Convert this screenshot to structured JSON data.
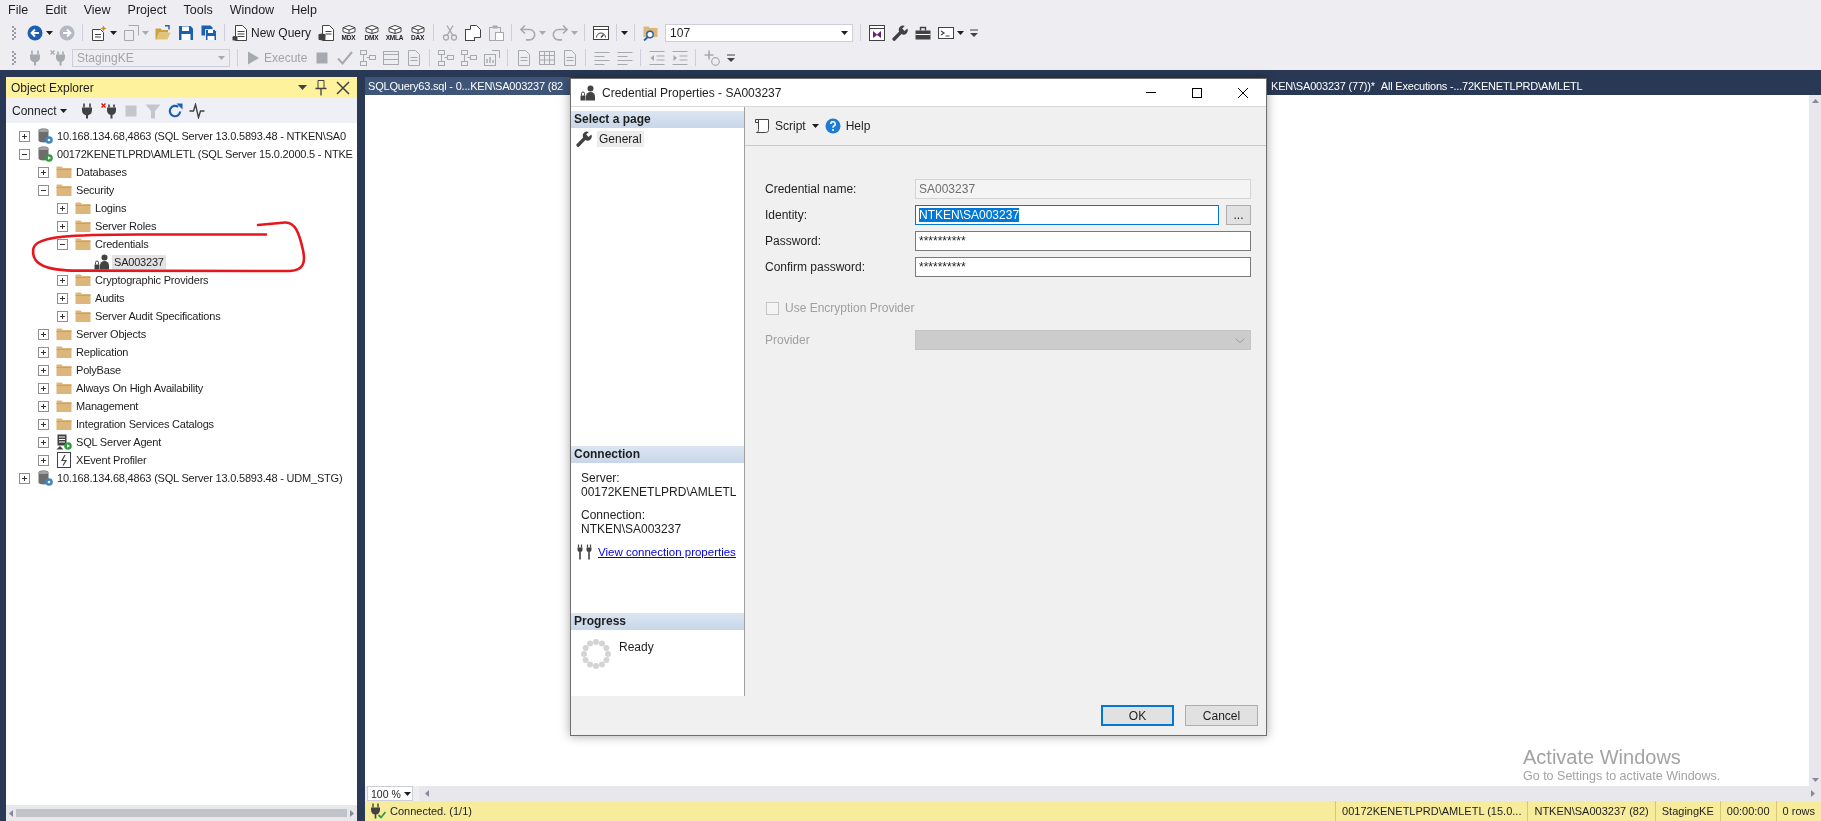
{
  "menu": [
    "File",
    "Edit",
    "View",
    "Project",
    "Tools",
    "Window",
    "Help"
  ],
  "toolbar": {
    "new_query": "New Query",
    "query_types": [
      "MDX",
      "DMX",
      "XMLA",
      "DAX"
    ],
    "find_box": {
      "value": "107"
    },
    "database": {
      "value": "StagingKE",
      "disabled": true
    },
    "execute": {
      "label": "Execute",
      "disabled": true
    }
  },
  "object_explorer": {
    "title": "Object Explorer",
    "connect": "Connect",
    "tree": [
      {
        "label": "10.168.134.68,4863 (SQL Server 13.0.5893.48 - NTKEN\\SA0",
        "kind": "server",
        "connected": false,
        "expanded": false,
        "selected": false
      },
      {
        "label": "00172KENETLPRD\\AMLETL (SQL Server 15.0.2000.5 - NTKE",
        "kind": "server",
        "connected": true,
        "expanded": true,
        "selected": false,
        "children": [
          {
            "label": "Databases",
            "kind": "folder",
            "expanded": false,
            "selected": false
          },
          {
            "label": "Security",
            "kind": "folder",
            "expanded": true,
            "selected": false,
            "children": [
              {
                "label": "Logins",
                "kind": "folder",
                "expanded": false,
                "selected": false
              },
              {
                "label": "Server Roles",
                "kind": "folder",
                "expanded": false,
                "selected": false
              },
              {
                "label": "Credentials",
                "kind": "folder",
                "expanded": true,
                "selected": false,
                "children": [
                  {
                    "label": "SA003237",
                    "kind": "credential",
                    "selected": true
                  }
                ]
              },
              {
                "label": "Cryptographic Providers",
                "kind": "folder",
                "expanded": false,
                "selected": false
              },
              {
                "label": "Audits",
                "kind": "folder",
                "expanded": false,
                "selected": false
              },
              {
                "label": "Server Audit Specifications",
                "kind": "folder",
                "expanded": false,
                "selected": false
              }
            ]
          },
          {
            "label": "Server Objects",
            "kind": "folder",
            "expanded": false,
            "selected": false
          },
          {
            "label": "Replication",
            "kind": "folder",
            "expanded": false,
            "selected": false
          },
          {
            "label": "PolyBase",
            "kind": "folder",
            "expanded": false,
            "selected": false
          },
          {
            "label": "Always On High Availability",
            "kind": "folder",
            "expanded": false,
            "selected": false
          },
          {
            "label": "Management",
            "kind": "folder",
            "expanded": false,
            "selected": false
          },
          {
            "label": "Integration Services Catalogs",
            "kind": "folder",
            "expanded": false,
            "selected": false
          },
          {
            "label": "SQL Server Agent",
            "kind": "agent",
            "expanded": false,
            "selected": false
          },
          {
            "label": "XEvent Profiler",
            "kind": "profiler",
            "expanded": false,
            "selected": false
          }
        ]
      },
      {
        "label": "10.168.134.68,4863 (SQL Server 13.0.5893.48 - UDM_STG)",
        "kind": "server",
        "connected": false,
        "expanded": false,
        "selected": false
      }
    ]
  },
  "editor": {
    "tabs": [
      {
        "label": "SQLQuery63.sql - 0...KEN\\SA003237 (82",
        "selected": true
      },
      {
        "label": "KEN\\SA003237 (77))*",
        "selected": false
      },
      {
        "label": "All Executions -...72KENETLPRD\\AMLETL",
        "selected": false
      }
    ],
    "zoom": "100 %"
  },
  "status_bar": {
    "message": "Connected. (1/1)",
    "fields": [
      "00172KENETLPRD\\AMLETL (15.0...",
      "NTKEN\\SA003237 (82)",
      "StagingKE",
      "00:00:00",
      "0 rows"
    ]
  },
  "dialog": {
    "title": "Credential Properties - SA003237",
    "pages_header": "Select a page",
    "pages": [
      {
        "label": "General",
        "selected": true
      }
    ],
    "connection": {
      "header": "Connection",
      "server_label": "Server:",
      "server": "00172KENETLPRD\\AMLETL",
      "connection_label": "Connection:",
      "connection": "NTKEN\\SA003237",
      "link": "View connection properties"
    },
    "progress": {
      "header": "Progress",
      "status": "Ready"
    },
    "toolbar": {
      "script": "Script",
      "help": "Help"
    },
    "fields": [
      {
        "kind": "text",
        "label": "Credential name:",
        "value": "SA003237",
        "disabled": true,
        "focused": false
      },
      {
        "kind": "browse",
        "label": "Identity:",
        "value": "NTKEN\\SA003237",
        "button": "...",
        "disabled": false,
        "focused": true
      },
      {
        "kind": "text",
        "label": "Password:",
        "value": "**********",
        "disabled": false,
        "focused": false
      },
      {
        "kind": "text",
        "label": "Confirm password:",
        "value": "**********",
        "disabled": false,
        "focused": false
      },
      {
        "kind": "checkbox",
        "label": "Use Encryption Provider",
        "checked": false,
        "disabled": true,
        "focused": false
      },
      {
        "kind": "dropdown",
        "label": "Provider",
        "disabled": true,
        "focused": false
      }
    ],
    "buttons": [
      {
        "label": "OK",
        "default": true
      },
      {
        "label": "Cancel",
        "default": false
      }
    ]
  },
  "notice": {
    "title": "Activate Windows",
    "text": "Go to Settings to activate Windows."
  }
}
